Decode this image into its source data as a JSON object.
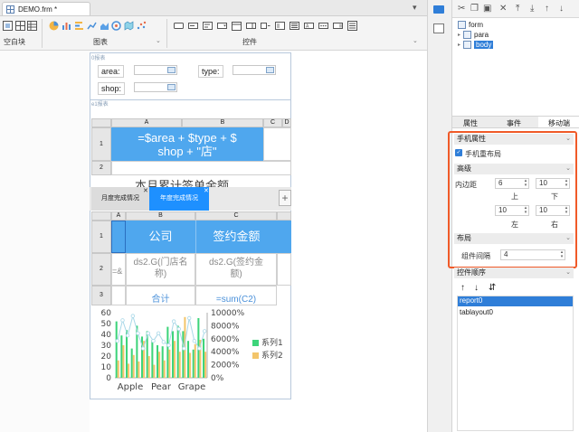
{
  "doc_tab": {
    "title": "DEMO.frm *"
  },
  "toolbar": {
    "groups": [
      {
        "label": "空白块"
      },
      {
        "label": "图表"
      },
      {
        "label": "控件"
      }
    ]
  },
  "page": {
    "section0_label": "0报表",
    "fields": [
      {
        "label": "area:"
      },
      {
        "label": "type:"
      },
      {
        "label": "shop:"
      }
    ],
    "section1_label": "e1报表",
    "top_sheet": {
      "cols": [
        "A",
        "B",
        "C",
        "D"
      ],
      "rows": [
        "1",
        "2"
      ],
      "formula": "=$area + $type + $ shop + \"店\"",
      "row3_text": "本月累计签单金额"
    },
    "tabs": [
      {
        "label": "月度完成情况"
      },
      {
        "label": "年度完成情况"
      }
    ],
    "add_tab": "+",
    "bottom_sheet": {
      "cols": [
        "A",
        "B",
        "C"
      ],
      "rows": [
        "1",
        "2",
        "3"
      ],
      "header_b": "公司",
      "header_c": "签约金额",
      "cell_a2": "=&",
      "cell_b2": "ds2.G(门店名称)",
      "cell_c2": "ds2.G(签约金额)",
      "cell_b3": "合计",
      "cell_c3": "=sum(C2)"
    }
  },
  "chart_data": {
    "type": "bar",
    "categories": [
      "Apple",
      "Pear",
      "Grape"
    ],
    "y_ticks_left": [
      "60",
      "50",
      "40",
      "30",
      "20",
      "10",
      "0"
    ],
    "y_ticks_right": [
      "10000%",
      "8000%",
      "6000%",
      "4000%",
      "2000%",
      "0%"
    ],
    "series": [
      {
        "name": "系列1",
        "color": "#3dd47a",
        "values": [
          52,
          39,
          44,
          27,
          48,
          38,
          43,
          35,
          30,
          29,
          47,
          43,
          48,
          43,
          34,
          26,
          55,
          36
        ]
      },
      {
        "name": "系列2",
        "color": "#f3c56b",
        "values": [
          16,
          30,
          13,
          21,
          15,
          34,
          20,
          12,
          24,
          16,
          26,
          34,
          24,
          56,
          23,
          31,
          35,
          24
        ]
      }
    ],
    "line_values": [
      34,
      53,
      39,
      57,
      41,
      27,
      41,
      34,
      41,
      33,
      30,
      52,
      45,
      27,
      55,
      34,
      27,
      43
    ],
    "ylim": [
      0,
      60
    ]
  },
  "right_panel": {
    "tree": [
      {
        "label": "form"
      },
      {
        "label": "para"
      },
      {
        "label": "body"
      }
    ],
    "tabs": [
      {
        "label": "属性"
      },
      {
        "label": "事件"
      },
      {
        "label": "移动端"
      }
    ],
    "mobile_attr": {
      "header": "手机属性",
      "relayout_label": "手机重布局",
      "advanced_header": "高级",
      "padding_label": "内边距",
      "pad_top": "6",
      "pad_bottom": "10",
      "pad_left": "10",
      "pad_right": "10",
      "top_label": "上",
      "bottom_label": "下",
      "left_label": "左",
      "right_label": "右",
      "layout_header": "布局",
      "spacing_label": "组件间隔",
      "spacing_value": "4"
    },
    "order_header": "控件顺序",
    "order_items": [
      {
        "label": "report0"
      },
      {
        "label": "tablayout0"
      }
    ]
  }
}
